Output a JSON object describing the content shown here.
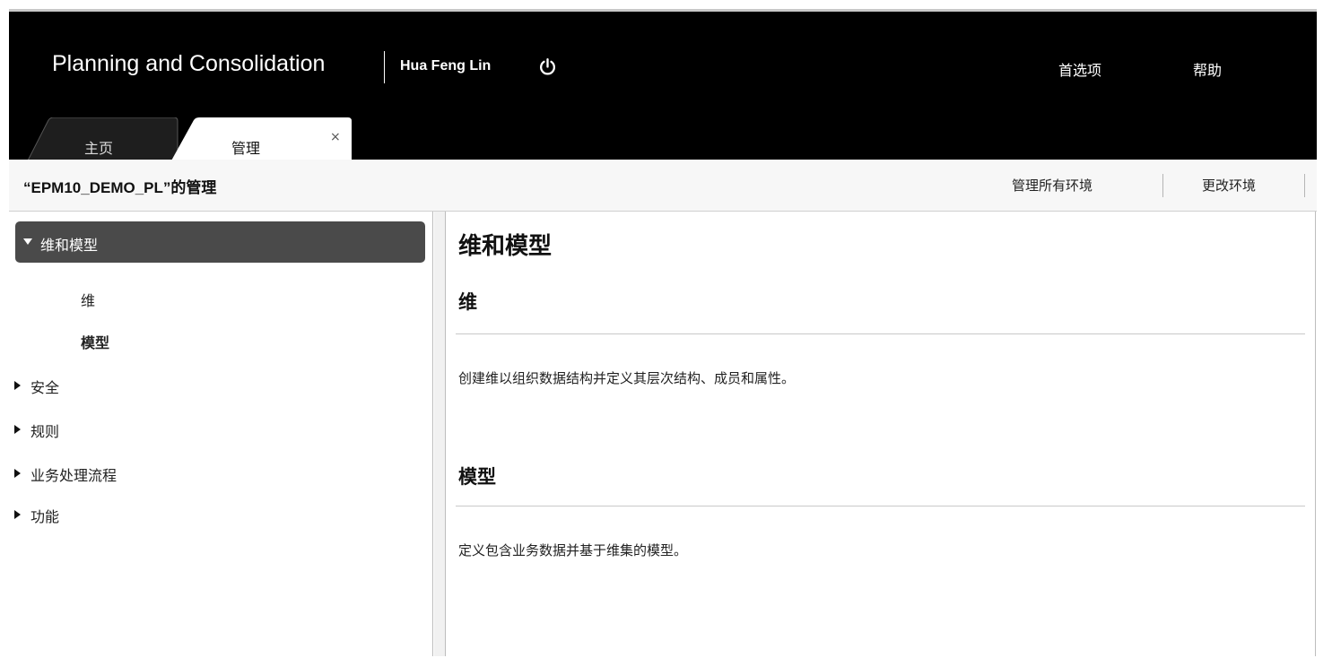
{
  "header": {
    "app_title": "Planning and Consolidation",
    "user_name": "Hua Feng Lin",
    "power_icon": "power-icon",
    "preferences_label": "首选项",
    "help_label": "帮助"
  },
  "tabs": [
    {
      "label": "主页",
      "active": false
    },
    {
      "label": "管理",
      "active": true,
      "close_label": "×"
    }
  ],
  "subbar": {
    "title": "“EPM10_DEMO_PL”的管理",
    "manage_all_label": "管理所有环境",
    "change_env_label": "更改环境"
  },
  "sidebar": {
    "active_group": {
      "label": "维和模型",
      "expanded": true
    },
    "sub_items": [
      {
        "label": "维"
      },
      {
        "label": "模型"
      }
    ],
    "items": [
      {
        "label": "安全"
      },
      {
        "label": "规则"
      },
      {
        "label": "业务处理流程"
      },
      {
        "label": "功能"
      }
    ]
  },
  "content": {
    "title": "维和模型",
    "sections": [
      {
        "title": "维",
        "description": "创建维以组织数据结构并定义其层次结构、成员和属性。"
      },
      {
        "title": "模型",
        "description": "定义包含业务数据并基于维集的模型。"
      }
    ]
  },
  "colors": {
    "header_bg": "#000000",
    "active_nav_bg": "#4a4a4a",
    "inactive_tab_bg": "#1e1e1e",
    "active_tab_bg": "#ffffff"
  }
}
